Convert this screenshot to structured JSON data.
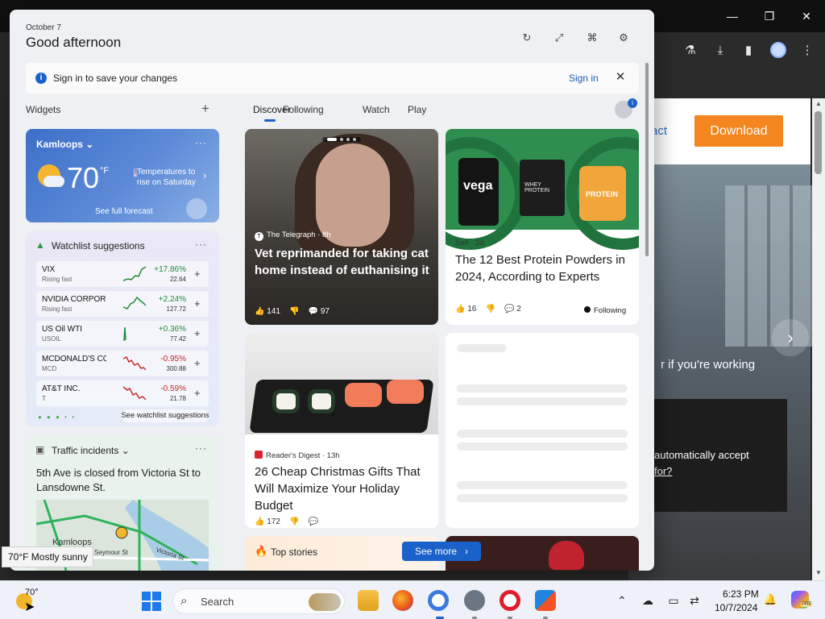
{
  "browser": {
    "minimize": "—",
    "maximize": "❐",
    "close": "✕",
    "header_link": "act",
    "download_label": "Download",
    "hero_text": "r if you're working",
    "hero_line1": "automatically accept",
    "hero_line2": "for?"
  },
  "panel": {
    "date": "October 7",
    "greeting": "Good afternoon",
    "signin_message": "Sign in to save your changes",
    "signin_link": "Sign in",
    "widgets_title": "Widgets",
    "add_symbol": "+",
    "more_symbol": "···",
    "tabs": [
      "Discover",
      "Following",
      "Watch",
      "Play"
    ],
    "avatar_badge": "i"
  },
  "weather": {
    "city": "Kamloops",
    "temp": "70",
    "unit": "°F",
    "note": "Temperatures to rise on Saturday",
    "forecast_link": "See full forecast"
  },
  "watchlist": {
    "title": "Watchlist suggestions",
    "see_more": "See watchlist suggestions",
    "items": [
      {
        "name": "VIX",
        "sub": "Rising fast",
        "change": "+17.86%",
        "price": "22.64"
      },
      {
        "name": "NVIDIA CORPOR...",
        "sub": "Rising fast",
        "change": "+2.24%",
        "price": "127.72"
      },
      {
        "name": "US Oil WTI",
        "sub": "USOIL",
        "change": "+0.36%",
        "price": "77.42"
      },
      {
        "name": "MCDONALD'S COR...",
        "sub": "MCD",
        "change": "-0.95%",
        "price": "300.88"
      },
      {
        "name": "AT&T INC.",
        "sub": "T",
        "change": "-0.59%",
        "price": "21.78"
      }
    ]
  },
  "traffic": {
    "title": "Traffic incidents",
    "text": "5th Ave is closed from Victoria St to Lansdowne St.",
    "map_city": "Kamloops",
    "map_street1": "Seymour St",
    "map_street2": "Victoria St"
  },
  "feed": {
    "card1": {
      "source": "The Telegraph · 8h",
      "headline": "Vet reprimanded for taking cat home instead of euthanising it",
      "likes": "141",
      "comments": "97"
    },
    "card2": {
      "source": "Self · 2d",
      "headline": "The 12 Best Protein Powders in 2024, According to Experts",
      "likes": "16",
      "comments": "2",
      "following": "Following",
      "product1": "vega",
      "product2": "WHEY PROTEIN",
      "product3": "PROTEIN"
    },
    "card3": {
      "source": "Reader's Digest · 13h",
      "headline": "26 Cheap Christmas Gifts That Will Maximize Your Holiday Budget",
      "likes": "172"
    },
    "top_stories": "Top stories",
    "see_more": "See more"
  },
  "tooltip": "70°F Mostly sunny",
  "taskbar": {
    "weather_temp": "70°",
    "search_placeholder": "Search",
    "time": "6:23 PM",
    "date": "10/7/2024",
    "copilot_badge": "PRE"
  },
  "colors": {
    "accent": "#1a62c9",
    "download": "#f3861f",
    "positive": "#1f8b3b",
    "negative": "#c62828"
  }
}
